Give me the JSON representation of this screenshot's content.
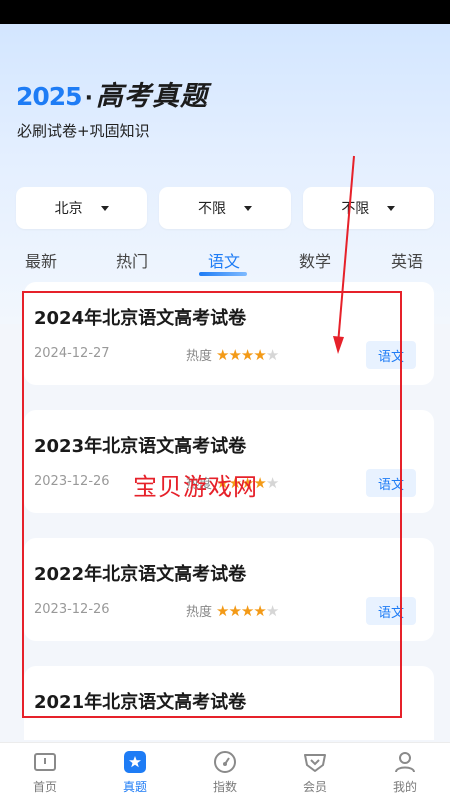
{
  "header": {
    "brand_year": "2025",
    "brand_dot": "·",
    "brand_title": "高考真题",
    "subtitle": "必刷试卷+巩固知识"
  },
  "filters": [
    {
      "label": "北京"
    },
    {
      "label": "不限"
    },
    {
      "label": "不限"
    }
  ],
  "tabs": [
    {
      "label": "最新",
      "active": false
    },
    {
      "label": "热门",
      "active": false
    },
    {
      "label": "语文",
      "active": true
    },
    {
      "label": "数学",
      "active": false
    },
    {
      "label": "英语",
      "active": false
    }
  ],
  "papers": [
    {
      "title": "2024年北京语文高考试卷",
      "date": "2024-12-27",
      "heat_label": "热度",
      "rating": 4,
      "max_rating": 5,
      "tag": "语文"
    },
    {
      "title": "2023年北京语文高考试卷",
      "date": "2023-12-26",
      "heat_label": "热度",
      "rating": 4,
      "max_rating": 5,
      "tag": "语文"
    },
    {
      "title": "2022年北京语文高考试卷",
      "date": "2023-12-26",
      "heat_label": "热度",
      "rating": 4,
      "max_rating": 5,
      "tag": "语文"
    },
    {
      "title": "2021年北京语文高考试卷",
      "date": "",
      "heat_label": "",
      "rating": 0,
      "max_rating": 5,
      "tag": ""
    }
  ],
  "watermark": "宝贝游戏网",
  "bottom_nav": [
    {
      "label": "首页",
      "icon": "book-icon",
      "active": false
    },
    {
      "label": "真题",
      "icon": "star-badge-icon",
      "active": true
    },
    {
      "label": "指数",
      "icon": "gauge-icon",
      "active": false
    },
    {
      "label": "会员",
      "icon": "vip-crown-icon",
      "active": false
    },
    {
      "label": "我的",
      "icon": "user-icon",
      "active": false
    }
  ],
  "colors": {
    "accent": "#1e7cf5",
    "star": "#f39a17",
    "annotation": "#e6212a"
  }
}
